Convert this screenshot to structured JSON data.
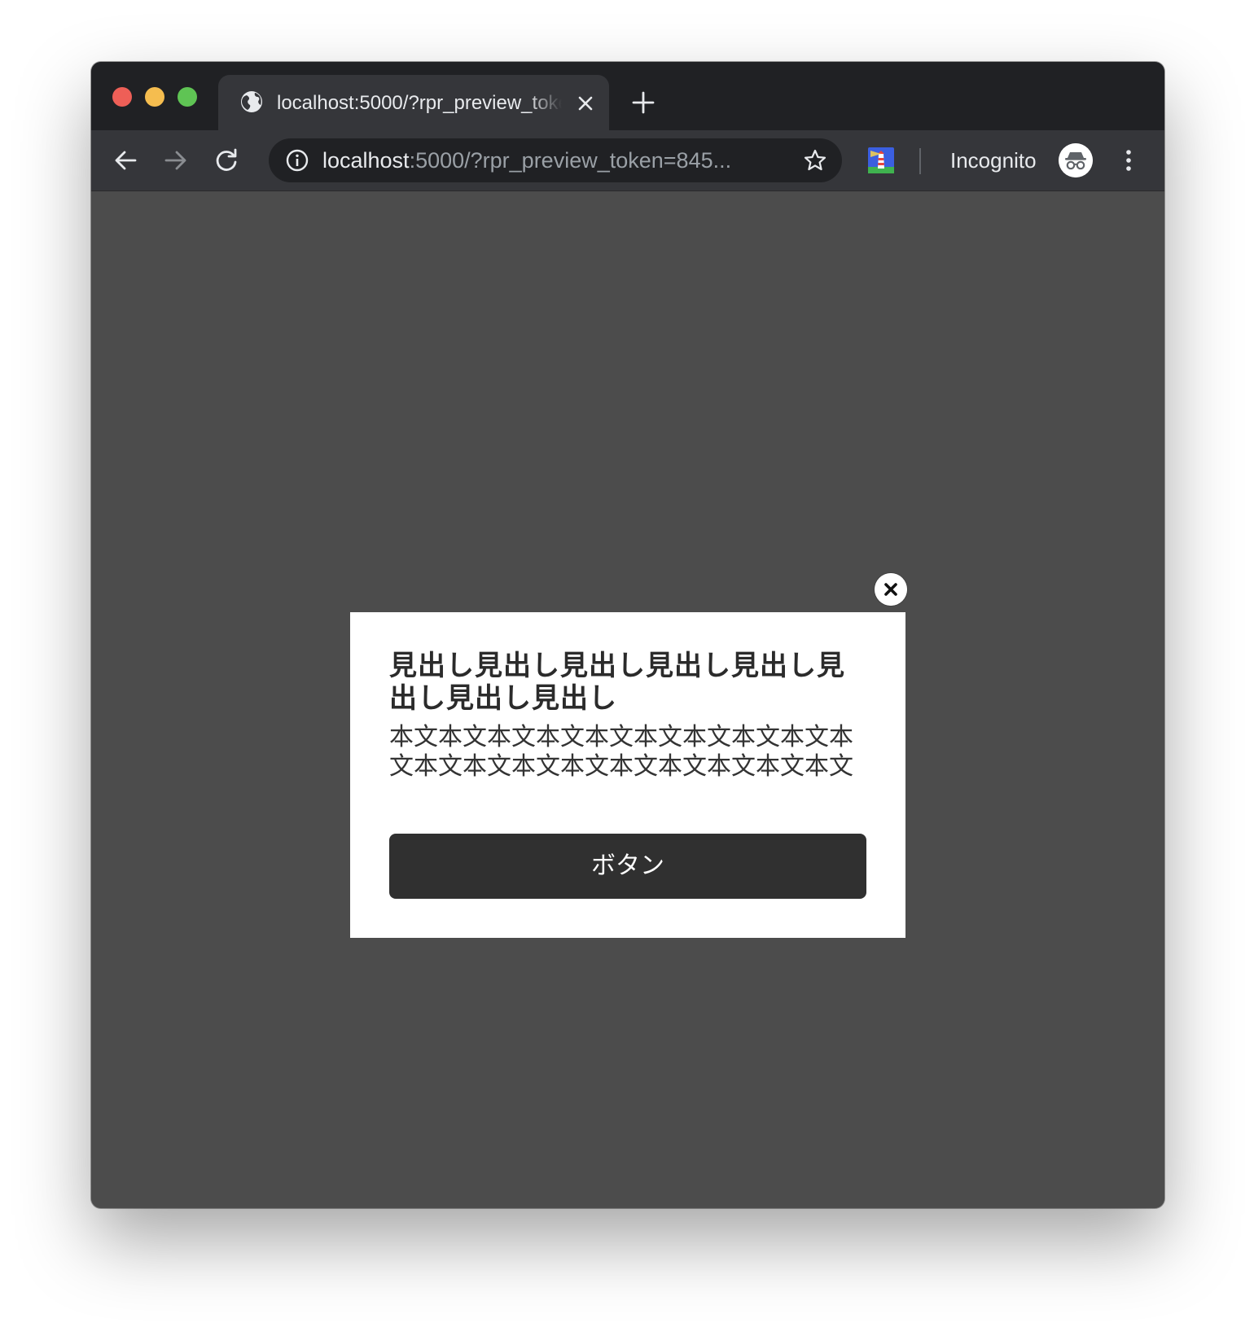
{
  "browser": {
    "tab": {
      "title": "localhost:5000/?rpr_preview_token=845..."
    },
    "address_bar": {
      "host": "localhost",
      "rest": ":5000/?rpr_preview_token=845..."
    },
    "profile_label": "Incognito",
    "icons": {
      "tab_favicon": "globe-icon",
      "tab_close": "close-icon",
      "new_tab": "plus-icon",
      "back": "arrow-left-icon",
      "forward": "arrow-right-icon",
      "reload": "reload-icon",
      "site_info": "info-icon",
      "bookmark": "star-icon",
      "extension": "lighthouse-extension-icon",
      "incognito": "incognito-icon",
      "menu": "kebab-menu-icon"
    }
  },
  "page": {
    "background_color": "#4c4c4c",
    "modal": {
      "heading": "見出し見出し見出し見出し見出し見出し見出し見出し",
      "body": "本文本文本文本文本文本文本文本文本文本文本文本文本文本文本文本文本文本文本文",
      "button_label": "ボタン",
      "close_icon": "close-icon",
      "button_color": "#303030"
    }
  }
}
